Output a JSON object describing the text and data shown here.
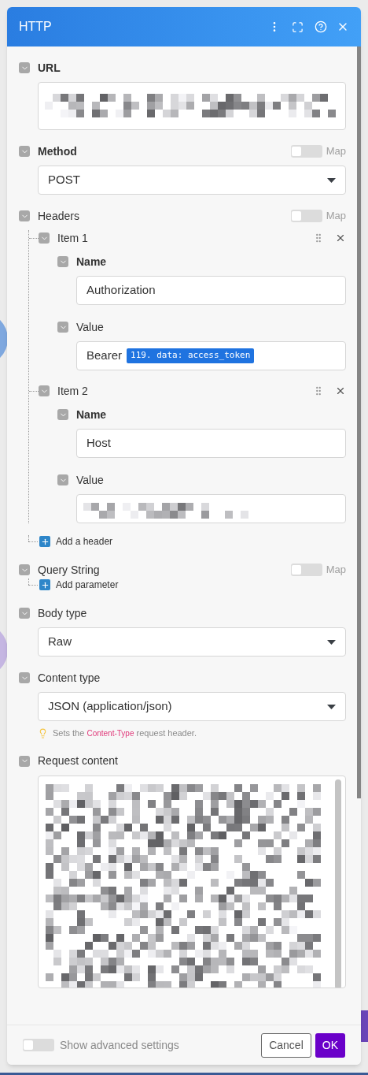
{
  "window": {
    "title": "HTTP"
  },
  "sections": [
    {
      "kind": "obscured_lines",
      "label": "URL",
      "bold": true,
      "expanded": true
    },
    {
      "kind": "select",
      "label": "Method",
      "bold": true,
      "expanded": true,
      "map": false,
      "map_label": "Map",
      "value": "POST"
    },
    {
      "kind": "list",
      "label": "Headers",
      "bold": false,
      "expanded": true,
      "map": false,
      "map_label": "Map",
      "add_label": "Add a header",
      "items": [
        {
          "label": "Item 1",
          "expanded": true,
          "fields": [
            {
              "kind": "text",
              "label": "Name",
              "bold": true,
              "expanded": true,
              "value": "Authorization"
            },
            {
              "kind": "token",
              "label": "Value",
              "bold": false,
              "expanded": true,
              "value": "Bearer",
              "token": "119. data: access_token"
            }
          ]
        },
        {
          "label": "Item 2",
          "expanded": true,
          "fields": [
            {
              "kind": "text",
              "label": "Name",
              "bold": true,
              "expanded": true,
              "value": "Host"
            },
            {
              "kind": "obscured_line",
              "label": "Value",
              "bold": false,
              "expanded": true
            }
          ]
        }
      ]
    },
    {
      "kind": "list",
      "label": "Query String",
      "bold": false,
      "expanded": true,
      "map": false,
      "map_label": "Map",
      "add_label": "Add parameter"
    },
    {
      "kind": "select",
      "label": "Body type",
      "bold": false,
      "expanded": true,
      "value": "Raw"
    },
    {
      "kind": "select",
      "label": "Content type",
      "bold": false,
      "expanded": true,
      "value": "JSON (application/json)",
      "hint": {
        "before": "Sets the ",
        "code": "Content-Type",
        "after": " request header."
      }
    },
    {
      "kind": "obscured_area",
      "label": "Request content",
      "bold": false,
      "expanded": true
    }
  ],
  "footer": {
    "advanced": {
      "label": "Show advanced settings",
      "on": false
    },
    "buttons": [
      {
        "label": "Cancel",
        "primary": false
      },
      {
        "label": "OK",
        "primary": true
      }
    ]
  }
}
